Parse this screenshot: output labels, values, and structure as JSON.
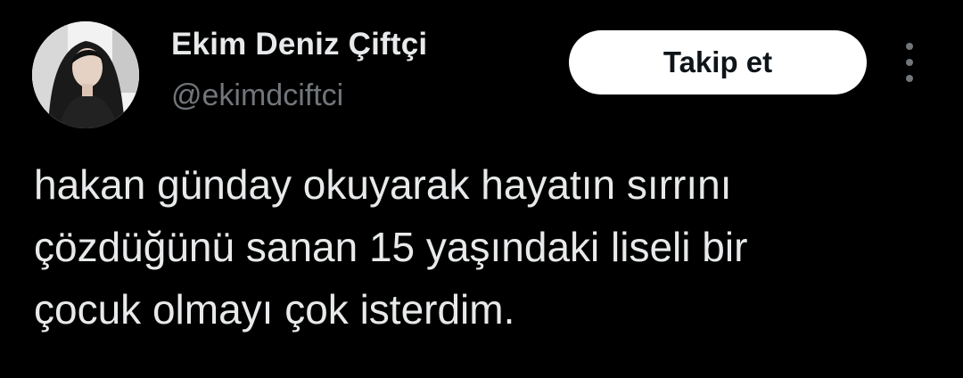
{
  "user": {
    "display_name": "Ekim Deniz Çiftçi",
    "handle": "@ekimdciftci",
    "avatar_icon": "profile-photo"
  },
  "actions": {
    "follow_label": "Takip et",
    "more_icon": "more-vertical-icon"
  },
  "tweet": {
    "lines": [
      "hakan günday okuyarak hayatın sırrını",
      "çözdüğünü sanan 15 yaşındaki liseli bir",
      "çocuk olmayı çok isterdim."
    ]
  },
  "colors": {
    "background": "#000000",
    "primary_text": "#e7e9ea",
    "secondary_text": "#71767b",
    "button_bg": "#ffffff",
    "button_text": "#0f1419"
  }
}
